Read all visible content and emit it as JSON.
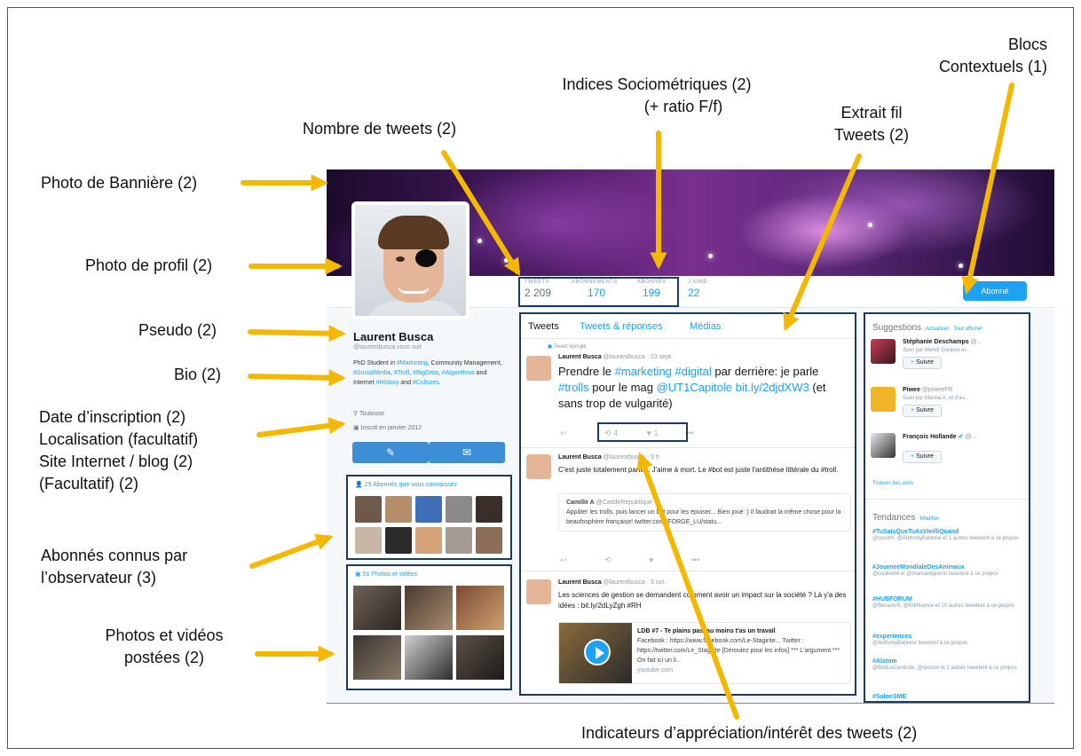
{
  "annotations": {
    "banner_photo": "Photo de Bannière (2)",
    "profile_photo": "Photo de profil (2)",
    "pseudo": "Pseudo (2)",
    "bio": "Bio (2)",
    "date_line1": "Date d’inscription (2)",
    "date_line2": "Localisation (facultatif)",
    "date_line3": "Site Internet / blog (2)",
    "date_line4": "(Facultatif) (2)",
    "known_line1": "Abonnés connus par",
    "known_line2": "l’observateur (3)",
    "photos_line1": "Photos et vidéos",
    "photos_line2": "postées (2)",
    "tweet_count": "Nombre de tweets (2)",
    "socio_line1": "Indices Sociométriques (2)",
    "socio_line2": "(+ ratio F/f)",
    "feed_line1": "Extrait fil",
    "feed_line2": "Tweets (2)",
    "blocks_line1": "Blocs",
    "blocks_line2": "Contextuels (1)",
    "appreciation": "Indicateurs d’appréciation/intérêt des tweets (2)"
  },
  "colors": {
    "arrow": "#f5b800",
    "box_border": "#1f3a5a",
    "twitter_blue": "#1da1f2"
  },
  "profile": {
    "stats": [
      {
        "label": "TWEETS",
        "value": "2 209"
      },
      {
        "label": "ABONNEMENTS",
        "value": "170"
      },
      {
        "label": "ABONNÉS",
        "value": "199"
      },
      {
        "label": "J'AIME",
        "value": "22"
      }
    ],
    "follow_button": "Abonné",
    "name": "Laurent Busca",
    "handle": "@laurentbusca vous suit",
    "bio_parts": [
      "PhD Student in ",
      "#Marketing",
      ", Community Management, ",
      "#SocialMedia",
      ", ",
      "#Troll",
      ", ",
      "#BigData",
      ", ",
      "#Algorithms",
      " and Internet ",
      "#History",
      " and ",
      "#Cultures",
      "."
    ],
    "location": "Toulouse",
    "joined": "Inscrit en janvier 2012",
    "known_followers_title": "29 Abonnés que vous connaissez",
    "photos_title": "51 Photos et vidéos"
  },
  "timeline": {
    "tabs": [
      "Tweets",
      "Tweets & réponses",
      "Médias"
    ],
    "pinned_label": "Tweet épinglé",
    "tweet1": {
      "author": "Laurent Busca",
      "meta": "@laurentbusca · 23 sept.",
      "text_parts": [
        "Prendre le ",
        "#marketing",
        " ",
        "#digital",
        " par derrière: je parle ",
        "#trolls",
        " pour le mag ",
        "@UT1Capitole",
        " ",
        "bit.ly/2djdXW3",
        " (et sans trop de vulgarité)"
      ],
      "retweets": "4",
      "likes": "1"
    },
    "tweet2": {
      "author": "Laurent Busca",
      "meta": "@laurentbusca · 9 h",
      "text": "C'est juste totalement parfait. J'aime à mort. Le #bot est juste l'antithèse littérale du #troll.",
      "quote_author": "Camille A",
      "quote_handle": "@CaddeRepublique",
      "quote_text": "Appâter les trolls, puis lancer un bot pour les épuiser... Bien joué :) Il faudrait la même chose pour la beaufosphère française! twitter.com /FORGE_LU/statu..."
    },
    "tweet3": {
      "author": "Laurent Busca",
      "meta": "@laurentbusca · 3 oct.",
      "text": "Les sciences de gestion se demandent comment avoir un impact sur la société ? Là y'a des idées : bit.ly/2dLyZgh #RH",
      "card_title": "LDB #7 - Te plains pas, au moins t'as un travail",
      "card_text": "Facebook : https://www.facebook.com/Le-Stagirite... Twitter : https://twitter.com/Le_Stagirite [Déroulez pour les infos] *** L'argument *** On fait ici un li...",
      "card_source": "youtube.com"
    }
  },
  "sidebar": {
    "suggestions_title": "Suggestions",
    "suggestions_links": " · Actualiser · Tout afficher",
    "suggestions": [
      {
        "name": "Stéphanie Deschamps",
        "handle": "@...",
        "sub": "Suivi par Mehdi Ouraoui et...",
        "button": "Suivre"
      },
      {
        "name": "Piwee",
        "handle": "@piweeFR",
        "sub": "Suivi par Marina A. et d'au...",
        "button": "Suivre"
      },
      {
        "name": "François Hollande",
        "handle": "@...",
        "sub": "",
        "button": "Suivre"
      }
    ],
    "find_friends": "Trouver des amis",
    "trends_title": "Tendances",
    "trends_link": " · Modifier",
    "trends": [
      {
        "tag": "#TuSaisQueTuAsVieilliQuand",
        "sub": "@rpoctm, @AnthonyBabkine et 1 autres tweetent à ce propos"
      },
      {
        "tag": "#JourneeMondialeDesAnimaux",
        "sub": "@cookie64 et @marcantiguerin tweetent à ce propos"
      },
      {
        "tag": "#HUBFORUM",
        "sub": "@Benavent, @linkfluence et 10 autres tweetent à ce propos"
      },
      {
        "tag": "#experiences",
        "sub": "@AnthonyBabkine tweetent à ce propos"
      },
      {
        "tag": "#Alstom",
        "sub": "@BobLeCentriste, @rpoctm et 2 autres tweetent à ce propos"
      },
      {
        "tag": "#SalonSME",
        "sub": ""
      }
    ]
  }
}
